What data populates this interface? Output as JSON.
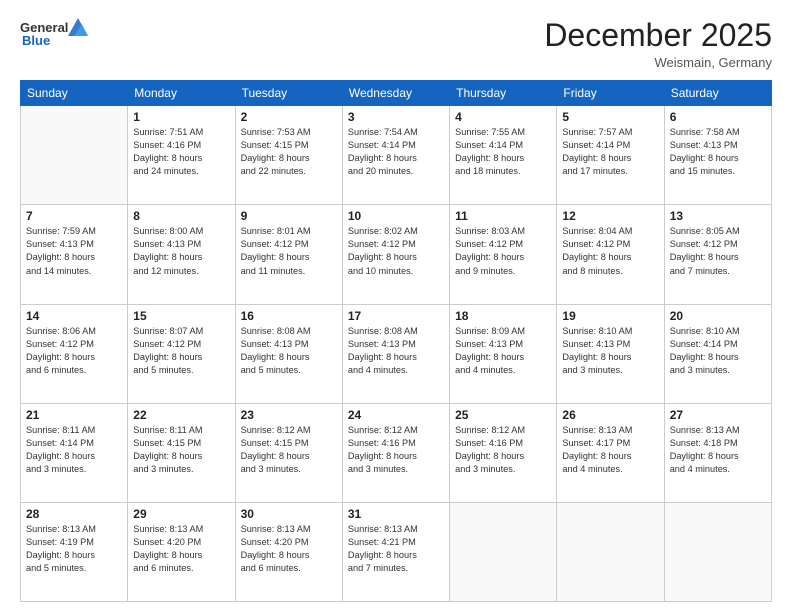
{
  "header": {
    "logo": {
      "general": "General",
      "blue": "Blue"
    },
    "title": "December 2025",
    "location": "Weismain, Germany"
  },
  "days": [
    "Sunday",
    "Monday",
    "Tuesday",
    "Wednesday",
    "Thursday",
    "Friday",
    "Saturday"
  ],
  "weeks": [
    [
      {
        "day": "",
        "info": ""
      },
      {
        "day": "1",
        "info": "Sunrise: 7:51 AM\nSunset: 4:16 PM\nDaylight: 8 hours\nand 24 minutes."
      },
      {
        "day": "2",
        "info": "Sunrise: 7:53 AM\nSunset: 4:15 PM\nDaylight: 8 hours\nand 22 minutes."
      },
      {
        "day": "3",
        "info": "Sunrise: 7:54 AM\nSunset: 4:14 PM\nDaylight: 8 hours\nand 20 minutes."
      },
      {
        "day": "4",
        "info": "Sunrise: 7:55 AM\nSunset: 4:14 PM\nDaylight: 8 hours\nand 18 minutes."
      },
      {
        "day": "5",
        "info": "Sunrise: 7:57 AM\nSunset: 4:14 PM\nDaylight: 8 hours\nand 17 minutes."
      },
      {
        "day": "6",
        "info": "Sunrise: 7:58 AM\nSunset: 4:13 PM\nDaylight: 8 hours\nand 15 minutes."
      }
    ],
    [
      {
        "day": "7",
        "info": "Sunrise: 7:59 AM\nSunset: 4:13 PM\nDaylight: 8 hours\nand 14 minutes."
      },
      {
        "day": "8",
        "info": "Sunrise: 8:00 AM\nSunset: 4:13 PM\nDaylight: 8 hours\nand 12 minutes."
      },
      {
        "day": "9",
        "info": "Sunrise: 8:01 AM\nSunset: 4:12 PM\nDaylight: 8 hours\nand 11 minutes."
      },
      {
        "day": "10",
        "info": "Sunrise: 8:02 AM\nSunset: 4:12 PM\nDaylight: 8 hours\nand 10 minutes."
      },
      {
        "day": "11",
        "info": "Sunrise: 8:03 AM\nSunset: 4:12 PM\nDaylight: 8 hours\nand 9 minutes."
      },
      {
        "day": "12",
        "info": "Sunrise: 8:04 AM\nSunset: 4:12 PM\nDaylight: 8 hours\nand 8 minutes."
      },
      {
        "day": "13",
        "info": "Sunrise: 8:05 AM\nSunset: 4:12 PM\nDaylight: 8 hours\nand 7 minutes."
      }
    ],
    [
      {
        "day": "14",
        "info": "Sunrise: 8:06 AM\nSunset: 4:12 PM\nDaylight: 8 hours\nand 6 minutes."
      },
      {
        "day": "15",
        "info": "Sunrise: 8:07 AM\nSunset: 4:12 PM\nDaylight: 8 hours\nand 5 minutes."
      },
      {
        "day": "16",
        "info": "Sunrise: 8:08 AM\nSunset: 4:13 PM\nDaylight: 8 hours\nand 5 minutes."
      },
      {
        "day": "17",
        "info": "Sunrise: 8:08 AM\nSunset: 4:13 PM\nDaylight: 8 hours\nand 4 minutes."
      },
      {
        "day": "18",
        "info": "Sunrise: 8:09 AM\nSunset: 4:13 PM\nDaylight: 8 hours\nand 4 minutes."
      },
      {
        "day": "19",
        "info": "Sunrise: 8:10 AM\nSunset: 4:13 PM\nDaylight: 8 hours\nand 3 minutes."
      },
      {
        "day": "20",
        "info": "Sunrise: 8:10 AM\nSunset: 4:14 PM\nDaylight: 8 hours\nand 3 minutes."
      }
    ],
    [
      {
        "day": "21",
        "info": "Sunrise: 8:11 AM\nSunset: 4:14 PM\nDaylight: 8 hours\nand 3 minutes."
      },
      {
        "day": "22",
        "info": "Sunrise: 8:11 AM\nSunset: 4:15 PM\nDaylight: 8 hours\nand 3 minutes."
      },
      {
        "day": "23",
        "info": "Sunrise: 8:12 AM\nSunset: 4:15 PM\nDaylight: 8 hours\nand 3 minutes."
      },
      {
        "day": "24",
        "info": "Sunrise: 8:12 AM\nSunset: 4:16 PM\nDaylight: 8 hours\nand 3 minutes."
      },
      {
        "day": "25",
        "info": "Sunrise: 8:12 AM\nSunset: 4:16 PM\nDaylight: 8 hours\nand 3 minutes."
      },
      {
        "day": "26",
        "info": "Sunrise: 8:13 AM\nSunset: 4:17 PM\nDaylight: 8 hours\nand 4 minutes."
      },
      {
        "day": "27",
        "info": "Sunrise: 8:13 AM\nSunset: 4:18 PM\nDaylight: 8 hours\nand 4 minutes."
      }
    ],
    [
      {
        "day": "28",
        "info": "Sunrise: 8:13 AM\nSunset: 4:19 PM\nDaylight: 8 hours\nand 5 minutes."
      },
      {
        "day": "29",
        "info": "Sunrise: 8:13 AM\nSunset: 4:20 PM\nDaylight: 8 hours\nand 6 minutes."
      },
      {
        "day": "30",
        "info": "Sunrise: 8:13 AM\nSunset: 4:20 PM\nDaylight: 8 hours\nand 6 minutes."
      },
      {
        "day": "31",
        "info": "Sunrise: 8:13 AM\nSunset: 4:21 PM\nDaylight: 8 hours\nand 7 minutes."
      },
      {
        "day": "",
        "info": ""
      },
      {
        "day": "",
        "info": ""
      },
      {
        "day": "",
        "info": ""
      }
    ]
  ]
}
